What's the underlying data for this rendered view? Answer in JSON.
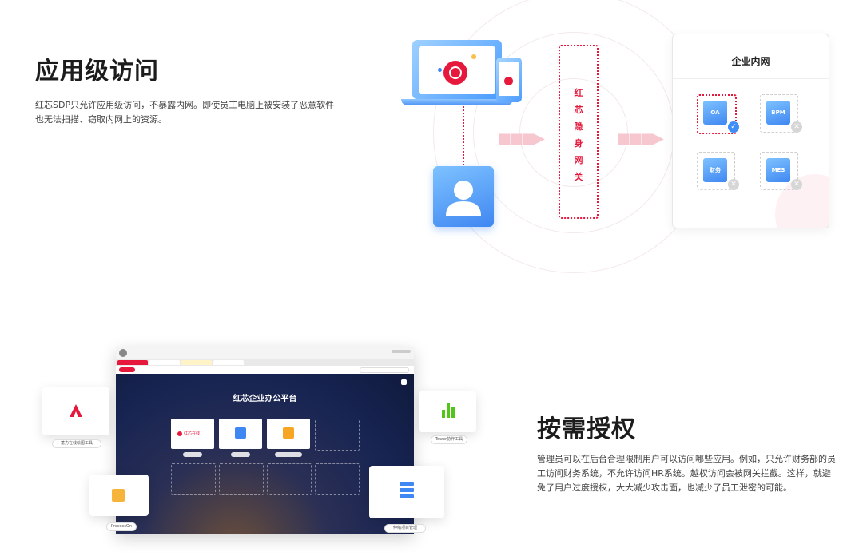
{
  "section1": {
    "title": "应用级访问",
    "description": "红芯SDP只允许应用级访问，不暴露内网。即使员工电脑上被安装了恶意软件也无法扫描、窃取内网上的资源。"
  },
  "diagram": {
    "gateway_chars": [
      "红",
      "芯",
      "隐",
      "身",
      "网",
      "关"
    ],
    "intranet_title": "企业内网",
    "apps": [
      {
        "label": "OA",
        "status": "allowed"
      },
      {
        "label": "BPM",
        "status": "blocked"
      },
      {
        "label": "财务",
        "status": "blocked"
      },
      {
        "label": "MES",
        "status": "blocked"
      }
    ],
    "colors": {
      "accent": "#e6193d",
      "blue": "#3f87f2"
    }
  },
  "section2": {
    "title": "按需授权",
    "description": "管理员可以在后台合理限制用户可以访问哪些应用。例如，只允许财务部的员工访问财务系统，不允许访问HR系统。越权访问会被网关拦截。这样，就避免了用户过度授权，大大减少攻击面，也减少了员工泄密的可能。"
  },
  "browser": {
    "platform_title": "红芯企业办公平台",
    "tile_logo_text": "红芯在线"
  },
  "float_cards": {
    "left_top_label": "蓄力在线绘图工具",
    "left_bottom_label": "ProcessOn",
    "right_top_label": "Tower协作工具",
    "right_bottom_label": "伸缩项目管理"
  }
}
